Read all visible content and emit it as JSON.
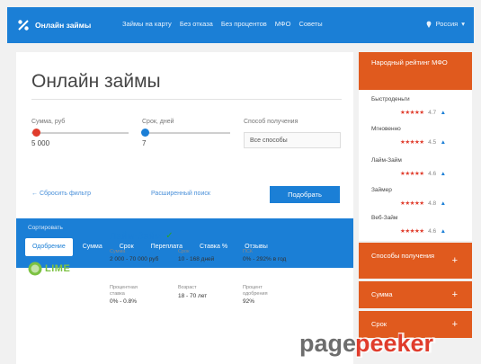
{
  "header": {
    "brand": "Онлайн займы",
    "nav": [
      "Займы на карту",
      "Без отказа",
      "Без процентов",
      "МФО",
      "Советы"
    ],
    "region": "Россия"
  },
  "main": {
    "title": "Онлайн займы",
    "filters": {
      "sum": {
        "label": "Сумма, руб",
        "value": "5 000",
        "fraction": 0.05
      },
      "term": {
        "label": "Срок, дней",
        "value": "7",
        "fraction": 0.03
      },
      "method": {
        "label": "Способ получения",
        "value": "Все способы"
      }
    },
    "reset_link": "← Сбросить фильтр",
    "extended_link": "Расширенный поиск",
    "submit": "Подобрать"
  },
  "sort": {
    "label": "Сортировать",
    "tabs": [
      {
        "label": "Одобрение",
        "active": true
      },
      {
        "label": "Сумма",
        "active": false
      },
      {
        "label": "Срок",
        "active": false
      },
      {
        "label": "Переплата",
        "active": false
      },
      {
        "label": "Ставка %",
        "active": false
      },
      {
        "label": "Отзывы",
        "active": false
      }
    ]
  },
  "offer": {
    "logo_text": "LIME",
    "title": "Лайм-Займ",
    "fields": [
      {
        "label": "Сумма",
        "value": "2 000 - 70 000 руб"
      },
      {
        "label": "Срок",
        "value": "10 - 168 дней"
      },
      {
        "label": "ПСК",
        "value": "0% - 292% в год"
      },
      {
        "label": "Процентная ставка",
        "value": "0% - 0.8%"
      },
      {
        "label": "Возраст",
        "value": "18 - 70 лет"
      },
      {
        "label": "Процент одобрения",
        "value": "92%"
      }
    ]
  },
  "sidebar": {
    "rating_title": "Народный рейтинг МФО",
    "rating": [
      {
        "name": "Быстроденьги",
        "score": "4.7"
      },
      {
        "name": "Мгновенно",
        "score": "4.5"
      },
      {
        "name": "Лайм-Займ",
        "score": "4.6"
      },
      {
        "name": "Займер",
        "score": "4.8"
      },
      {
        "name": "Веб-Займ",
        "score": "4.6"
      }
    ],
    "stars": "★★★★★",
    "arrow": "▲",
    "accordion": [
      "Способы получения",
      "Сумма",
      "Срок"
    ],
    "plus": "+"
  },
  "colors": {
    "header_blue": "#1b7fd6",
    "sidebar_orange": "#e05a1e",
    "star_red": "#e03c2c",
    "lime_green": "#7cc242"
  },
  "icons": {
    "brand": "percent-icon",
    "region": "location-pin-icon",
    "thumb": "slider-thumb-icon",
    "check": "check-icon",
    "plus": "plus-icon",
    "logo": "lime-logo",
    "watermark": "pagepeeker-watermark"
  }
}
